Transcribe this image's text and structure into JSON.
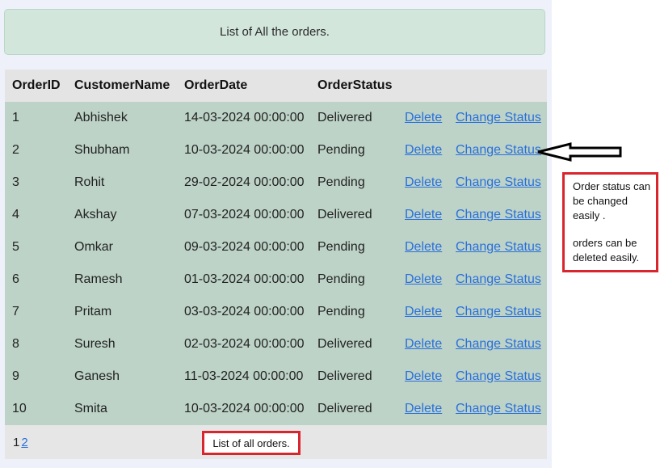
{
  "alert_text": "List of All the orders.",
  "table": {
    "headers": [
      "OrderID",
      "CustomerName",
      "OrderDate",
      "OrderStatus"
    ],
    "rows": [
      {
        "id": "1",
        "customer": "Abhishek",
        "date": "14-03-2024 00:00:00",
        "status": "Delivered"
      },
      {
        "id": "2",
        "customer": "Shubham",
        "date": "10-03-2024 00:00:00",
        "status": "Pending"
      },
      {
        "id": "3",
        "customer": "Rohit",
        "date": "29-02-2024 00:00:00",
        "status": "Pending"
      },
      {
        "id": "4",
        "customer": "Akshay",
        "date": "07-03-2024 00:00:00",
        "status": "Delivered"
      },
      {
        "id": "5",
        "customer": "Omkar",
        "date": "09-03-2024 00:00:00",
        "status": "Pending"
      },
      {
        "id": "6",
        "customer": "Ramesh",
        "date": "01-03-2024 00:00:00",
        "status": "Pending"
      },
      {
        "id": "7",
        "customer": "Pritam",
        "date": "03-03-2024 00:00:00",
        "status": "Pending"
      },
      {
        "id": "8",
        "customer": "Suresh",
        "date": "02-03-2024 00:00:00",
        "status": "Delivered"
      },
      {
        "id": "9",
        "customer": "Ganesh",
        "date": "11-03-2024 00:00:00",
        "status": "Delivered"
      },
      {
        "id": "10",
        "customer": "Smita",
        "date": "10-03-2024 00:00:00",
        "status": "Delivered"
      }
    ],
    "delete_label": "Delete",
    "change_status_label": "Change Status"
  },
  "pager": {
    "current": "1",
    "next": "2"
  },
  "footer_note": "List of all orders.",
  "annotation": {
    "line1": "Order status can be changed easily .",
    "line2": "orders can be deleted easily."
  },
  "colors": {
    "accent_red": "#d9262e",
    "link": "#2a6fdb",
    "row_bg": "#bdd3c7",
    "alert_bg": "#d2e6dc"
  }
}
